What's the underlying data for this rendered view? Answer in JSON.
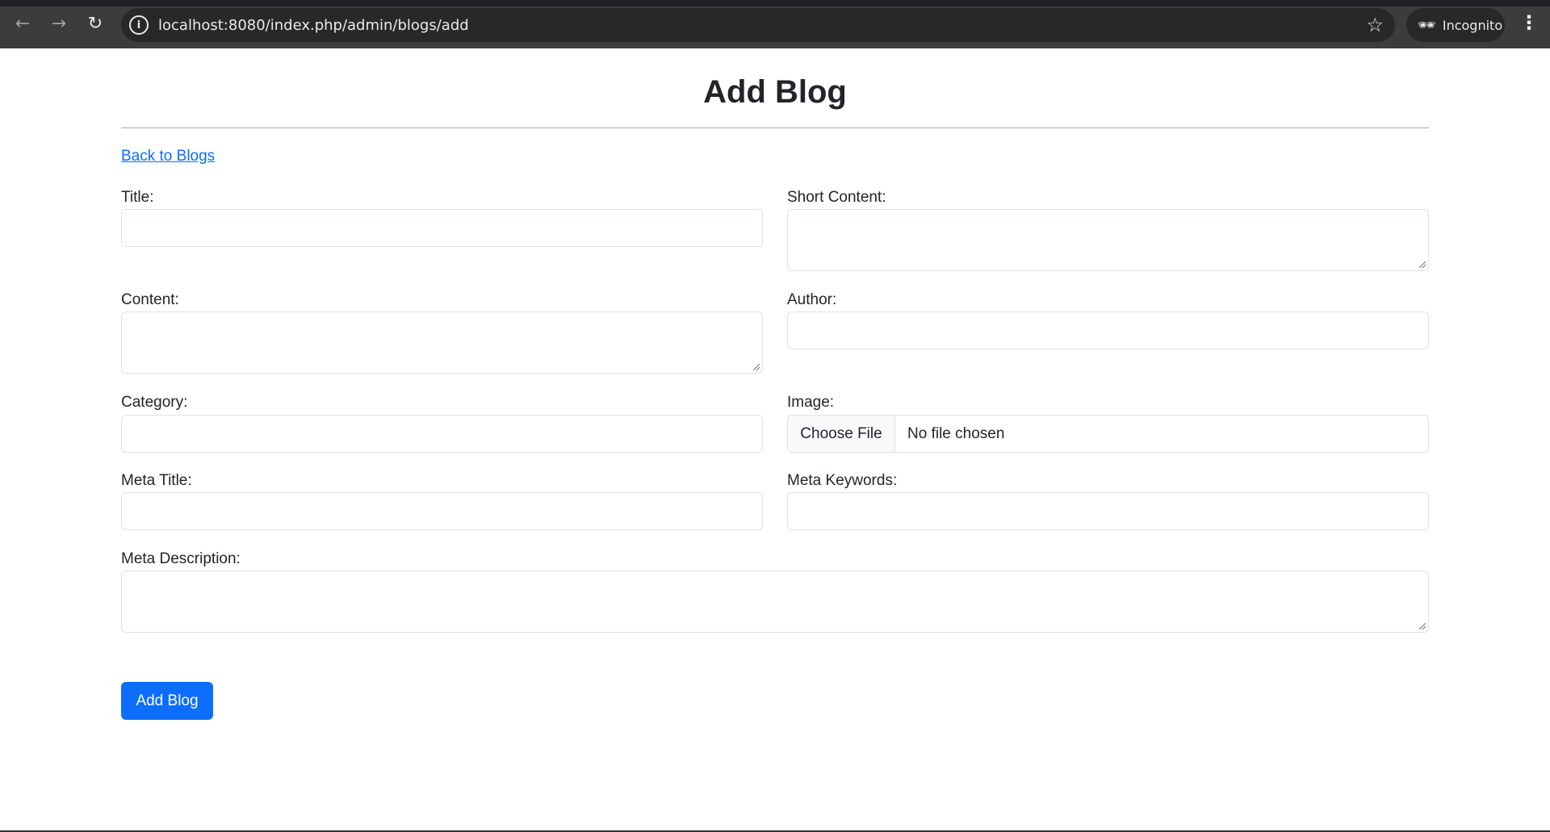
{
  "browser": {
    "url": "localhost:8080/index.php/admin/blogs/add",
    "incognito_label": "Incognito",
    "icons": [
      "back-arrow-icon",
      "forward-arrow-icon",
      "reload-icon",
      "site-info-icon",
      "bookmark-star-icon",
      "incognito-icon",
      "more-menu-icon"
    ]
  },
  "page": {
    "title": "Add Blog",
    "back_link": "Back to Blogs"
  },
  "form": {
    "title_label": "Title:",
    "short_content_label": "Short Content:",
    "content_label": "Content:",
    "author_label": "Author:",
    "category_label": "Category:",
    "image_label": "Image:",
    "choose_file": "Choose File",
    "no_file": "No file chosen",
    "meta_title_label": "Meta Title:",
    "meta_keywords_label": "Meta Keywords:",
    "meta_description_label": "Meta Description:",
    "submit": "Add Blog"
  },
  "colors": {
    "primary": "#0d6efd",
    "text": "#212529",
    "border": "#dee2e6",
    "chrome": "#3c3c3c"
  }
}
